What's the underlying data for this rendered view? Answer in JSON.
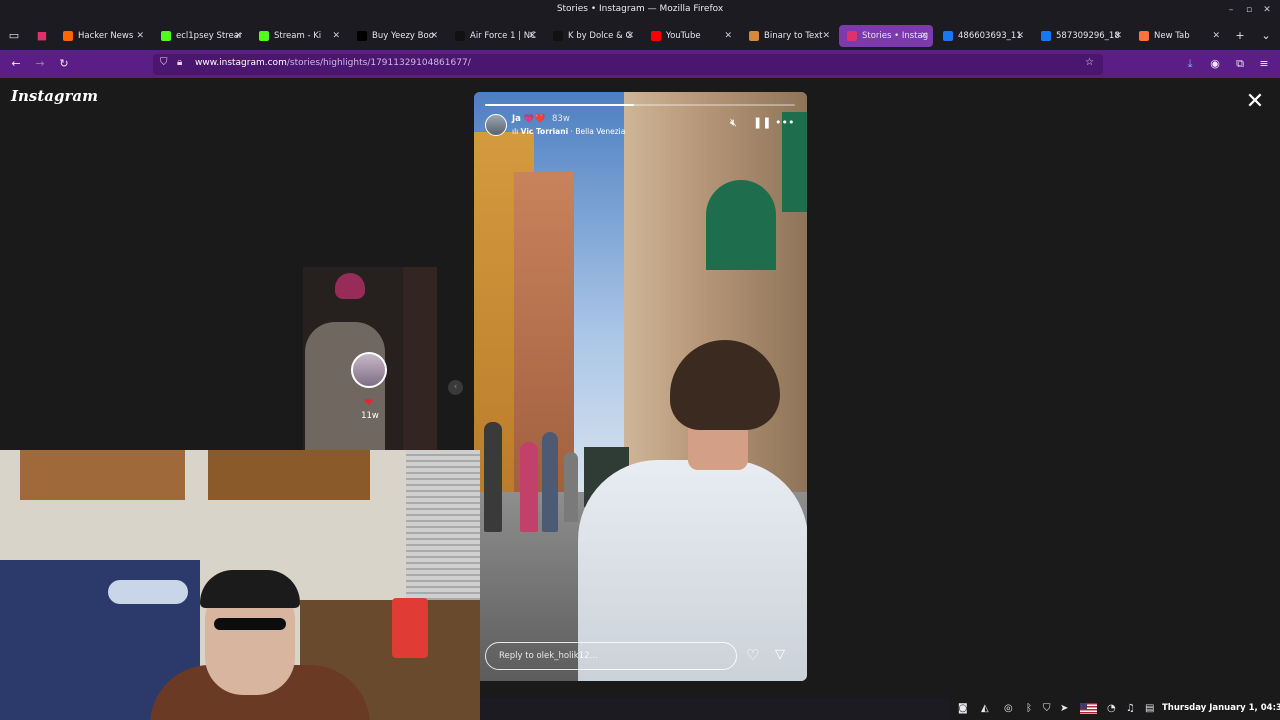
{
  "window": {
    "title": "Stories • Instagram — Mozilla Firefox"
  },
  "tabs": [
    {
      "label": "Hacker News",
      "icon": "y-icon",
      "color": "#ff6600"
    },
    {
      "label": "ecl1psey Stream",
      "icon": "kick-icon",
      "color": "#53fc18"
    },
    {
      "label": "Stream - Ki",
      "icon": "kick-icon",
      "color": "#53fc18"
    },
    {
      "label": "Buy Yeezy Boo",
      "icon": "page-icon",
      "color": "#000000"
    },
    {
      "label": "Air Force 1 | NC",
      "icon": "nike-icon",
      "color": "#111111"
    },
    {
      "label": "K by Dolce & G",
      "icon": "page-icon",
      "color": "#111111"
    },
    {
      "label": "YouTube",
      "icon": "youtube-icon",
      "color": "#ff0000"
    },
    {
      "label": "Binary to Text",
      "icon": "page-icon",
      "color": "#d7863a"
    },
    {
      "label": "Stories • Instag",
      "icon": "instagram-icon",
      "color": "#e1306c",
      "active": true
    },
    {
      "label": "486603693_11",
      "icon": "facebook-icon",
      "color": "#1877f2"
    },
    {
      "label": "587309296_18",
      "icon": "facebook-icon",
      "color": "#1877f2"
    },
    {
      "label": "New Tab",
      "icon": "firefox-icon",
      "color": "#ff7139"
    }
  ],
  "address": {
    "host": "www.instagram.com",
    "path": "/stories/highlights/17911329104861677/"
  },
  "instagram": {
    "logo": "Instagram"
  },
  "side_story": {
    "heart": "❤",
    "time": "11w"
  },
  "story": {
    "username": "Ja 💗❤️",
    "time": "83w",
    "music_artist": "Vic Torriani",
    "music_separator": " · ",
    "music_track": "Bella Venezia",
    "progress": 0.48,
    "reply_placeholder": "Reply to olek_holik12..."
  },
  "tray": {
    "clock": "Thursday January 1, 04:39"
  },
  "colors": {
    "accent": "#7c3aad",
    "navbar": "#5b1e86"
  }
}
